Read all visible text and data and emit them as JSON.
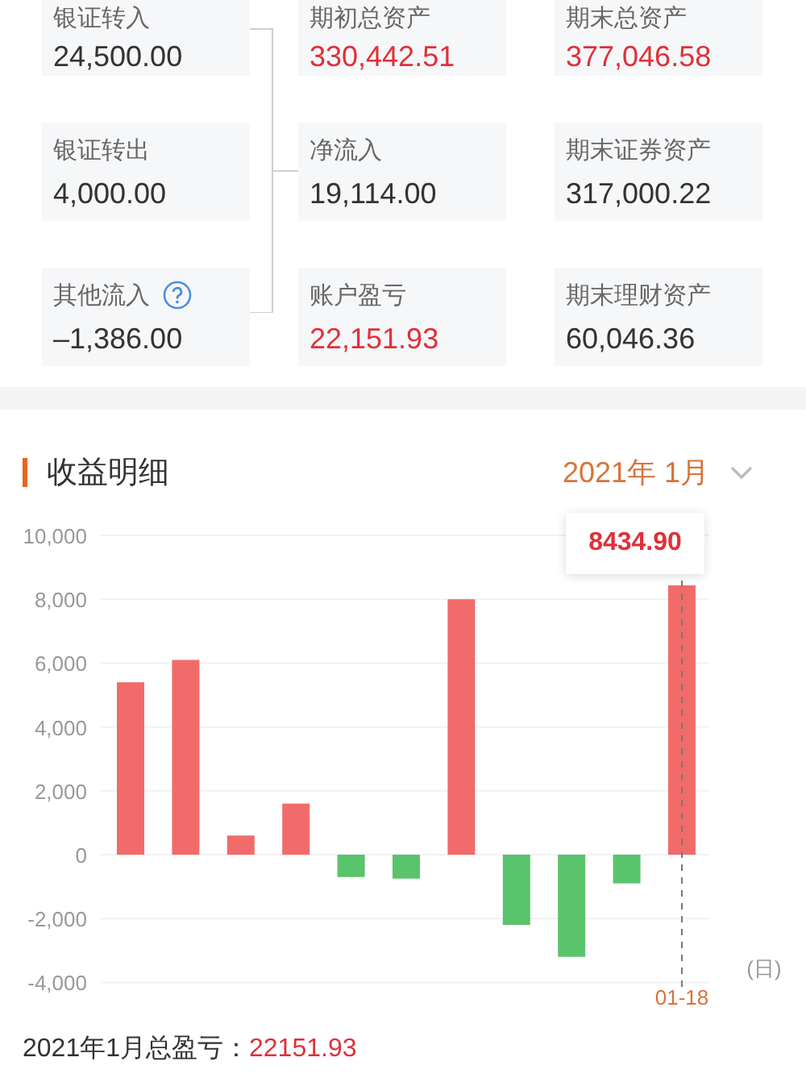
{
  "summary": {
    "cards": [
      {
        "label": "银证转入",
        "value": "24,500.00",
        "highlight": false,
        "help": false
      },
      {
        "label": "期初总资产",
        "value": "330,442.51",
        "highlight": true,
        "help": false
      },
      {
        "label": "期末总资产",
        "value": "377,046.58",
        "highlight": true,
        "help": false
      },
      {
        "label": "银证转出",
        "value": "4,000.00",
        "highlight": false,
        "help": false
      },
      {
        "label": "净流入",
        "value": "19,114.00",
        "highlight": false,
        "help": false
      },
      {
        "label": "期末证券资产",
        "value": "317,000.22",
        "highlight": false,
        "help": false
      },
      {
        "label": "其他流入",
        "value": "–1,386.00",
        "highlight": false,
        "help": true
      },
      {
        "label": "账户盈亏",
        "value": "22,151.93",
        "highlight": true,
        "help": false
      },
      {
        "label": "期末理财资产",
        "value": "60,046.36",
        "highlight": false,
        "help": false
      }
    ]
  },
  "detail": {
    "title": "收益明细",
    "period": "2021年 1月",
    "chart_data": {
      "type": "bar",
      "xlabel": "(日)",
      "ylim": [
        -4000,
        10000
      ],
      "yticks": [
        {
          "value": -4000,
          "label": "-4,000"
        },
        {
          "value": -2000,
          "label": "-2,000"
        },
        0,
        {
          "value": 2000,
          "label": "2,000"
        },
        {
          "value": 4000,
          "label": "4,000"
        },
        {
          "value": 6000,
          "label": "6,000"
        },
        {
          "value": 8000,
          "label": "8,000"
        },
        {
          "value": 10000,
          "label": "10,000"
        }
      ],
      "grid": true,
      "categories": [
        null,
        null,
        null,
        null,
        null,
        null,
        null,
        null,
        null,
        null,
        "01-18"
      ],
      "values": [
        5400,
        6100,
        600,
        1600,
        -700,
        -750,
        8000,
        -2200,
        -3200,
        -900,
        8434.9
      ],
      "annotations": [
        "8434.90"
      ]
    },
    "total_label": "2021年1月总盈亏：",
    "total_value": "22151.93"
  }
}
